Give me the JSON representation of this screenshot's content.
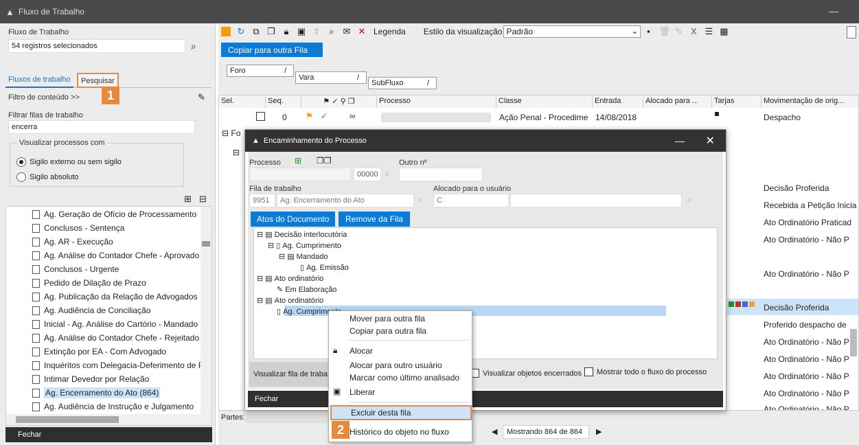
{
  "window": {
    "title": "Fluxo de Trabalho"
  },
  "left": {
    "fluxo_label": "Fluxo de Trabalho",
    "fluxo_value": "54 registros selecionados",
    "tabs": [
      "Fluxos de trabalho",
      "Pesquisar"
    ],
    "badge1": "1",
    "filtro_conteudo": "Filtro de conteúdo >>",
    "filtrar_label": "Filtrar filas de trabalho",
    "filtrar_value": "encerra",
    "visualizar_label": "Visualizar processos com",
    "radio1": "Sigilo externo ou sem sigilo",
    "radio2": "Sigilo absoluto",
    "tree_items": [
      "Ag. Geração de Ofício de Processamento",
      "Conclusos - Sentença",
      "Ag. AR - Execução",
      "Ag. Análise do Contador Chefe - Aprovado",
      "Conclusos - Urgente",
      "Pedido de Dilação de Prazo",
      "Ag. Publicação da Relação de Advogados",
      "Ag. Audiência de Conciliação",
      "Inicial - Ag. Análise do Cartório - Mandado",
      "Ag. Análise do Contador Chefe - Rejeitado",
      "Extinção por EA - Com Advogado",
      "Inquéritos com Delegacia-Deferimento de P",
      "Intimar Devedor por Relação",
      "Ag. Encerramento do Ato (864)",
      "Ag. Audiência de Instrução e Julgamento"
    ],
    "fechar": "Fechar"
  },
  "toolbar": {
    "legenda": "Legenda",
    "estilo_label": "Estilo da visualização",
    "estilo_value": "Padrão"
  },
  "copiar_btn": "Copiar para outra Fila",
  "group_boxes": [
    "Foro",
    "Vara",
    "SubFluxo"
  ],
  "grid": {
    "headers": [
      "Sel.",
      "Seq.",
      "Processo",
      "Classe",
      "Entrada",
      "Alocado para ...",
      "Tarjas",
      "Movimentação de orig..."
    ],
    "row1": {
      "seq": "0",
      "classe": "Ação Penal - Procedime",
      "entrada": "14/08/2018",
      "mov": "Despacho"
    },
    "group_prefix": "Fo",
    "movs": [
      "Decisão Proferida",
      "Recebida a Petição Inicia",
      "Ato Ordinatório Praticad",
      "Ato Ordinatório - Não P",
      "Ato Ordinatório - Não P",
      "Decisão Proferida",
      "Proferido despacho de",
      "Ato Ordinatório - Não P",
      "Ato Ordinatório - Não P",
      "Ato Ordinatório - Não P",
      "Ato Ordinatório - Não P",
      "Ato Ordinatório - Não P"
    ],
    "partes": "Partes:",
    "mostrando": "Mostrando 864 de 864"
  },
  "modal": {
    "title": "Encaminhamento do Processo",
    "processo_label": "Processo",
    "processo_suffix": "00000",
    "outro_label": "Outro nº",
    "fila_label": "Fila de trabalho",
    "fila_code": "9951",
    "fila_name": "Ag. Encerramento do Ato",
    "alocado_label": "Alocado para o usuário",
    "alocado_value": "C",
    "btn_atos": "Atos do Documento",
    "btn_remove": "Remove da Fila",
    "tree": [
      "Decisão interlocutória",
      "Ag. Cumprimento",
      "Mandado",
      "Ag. Emissão",
      "Ato ordinatório",
      "Em Elaboração",
      "Ato ordinatório",
      "Ag. Cumprimento"
    ],
    "visualizar_fila": "Visualizar fila de traba",
    "visualizar_obj": "Visualizar objetos encerrados",
    "mostrar_todo": "Mostrar todo o fluxo do processo",
    "fechar": "Fechar"
  },
  "context_menu": {
    "items": [
      "Mover para outra fila",
      "Copiar para outra fila",
      "Alocar",
      "Alocar para outro usuário",
      "Marcar como último analisado",
      "Liberar",
      "Excluir desta fila",
      "Histórico do objeto no fluxo"
    ],
    "badge2": "2"
  },
  "colors": {
    "accent": "#0b7bd6",
    "highlight": "#e88a3c",
    "title_bg": "#4a4a4a"
  }
}
